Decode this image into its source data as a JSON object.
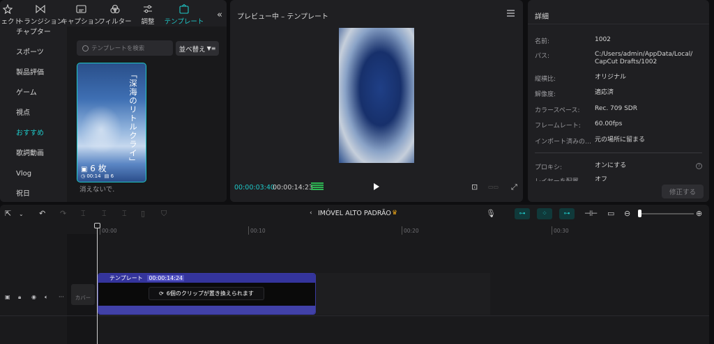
{
  "toptabs": [
    {
      "label": "フェクト",
      "icon": "effects-icon"
    },
    {
      "label": "トランジション",
      "icon": "transition-icon"
    },
    {
      "label": "キャプション",
      "icon": "caption-icon"
    },
    {
      "label": "フィルター",
      "icon": "filter-icon"
    },
    {
      "label": "調整",
      "icon": "adjust-icon"
    },
    {
      "label": "テンプレート",
      "icon": "template-icon",
      "active": true
    }
  ],
  "sidebar": {
    "items": [
      "チャプター",
      "スポーツ",
      "製品評価",
      "ゲーム",
      "視点",
      "おすすめ",
      "歌詞動画",
      "Vlog",
      "祝日"
    ],
    "active_index": 5
  },
  "media": {
    "search_placeholder": "テンプレートを検索",
    "sort_label": "並べ替え",
    "card": {
      "vertical_text": "「深海のリトルクライ」",
      "count": "6 枚",
      "duration": "00:14",
      "clips": "6",
      "title": "消えないで."
    }
  },
  "preview": {
    "title": "プレビュー中 – テンプレート",
    "current_time": "00:00:03:40",
    "total_time": "00:00:14:23"
  },
  "details": {
    "title": "詳細",
    "rows": [
      {
        "key": "名前:",
        "value": "1002"
      },
      {
        "key": "パス:",
        "value": "C:/Users/admin/AppData/Local/\nCapCut Drafts/1002"
      },
      {
        "key": "縦横比:",
        "value": "オリジナル"
      },
      {
        "key": "解像度:",
        "value": "適応済"
      },
      {
        "key": "カラースペース:",
        "value": "Rec. 709 SDR"
      },
      {
        "key": "フレームレート:",
        "value": "60.00fps"
      },
      {
        "key": "インポート済みの…",
        "value": "元の場所に留まる"
      }
    ],
    "proxy_key": "プロキシ:",
    "proxy_value": "オンにする",
    "layer_key": "レイヤーを配置",
    "layer_value": "オフ",
    "fix_button": "修正する"
  },
  "timeline": {
    "project_name": "IMÓVEL ALTO PADRÃO",
    "ruler_ticks": [
      "00:00",
      "00:10",
      "00:20",
      "00:30"
    ],
    "cover_label": "カバー",
    "clip": {
      "title": "テンプレート",
      "duration": "00:00:14:24",
      "message": "6個のクリップが置き換えられます"
    }
  },
  "colors": {
    "accent": "#1fc7c7",
    "clip": "#34349c",
    "panel": "#1f1f22"
  }
}
